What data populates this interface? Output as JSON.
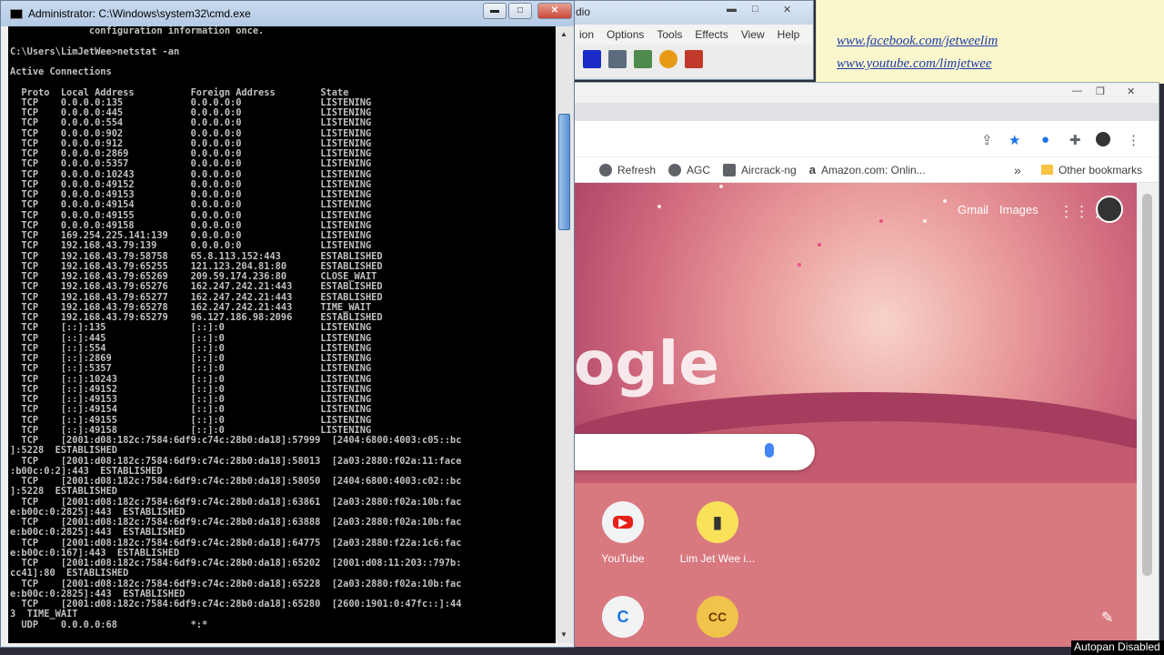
{
  "audio_app": {
    "title": "dio",
    "menu": [
      "ion",
      "Options",
      "Tools",
      "Effects",
      "View",
      "Help"
    ]
  },
  "note": {
    "link1": "www.facebook.com/jetweelim",
    "link2": "www.youtube.com/limjetwee"
  },
  "chrome": {
    "bookmarks": [
      {
        "label": "Refresh"
      },
      {
        "label": "AGC"
      },
      {
        "label": "Aircrack-ng"
      },
      {
        "label": "Amazon.com: Onlin..."
      }
    ],
    "more_bookmarks": "»",
    "other_bookmarks": "Other bookmarks",
    "gmail": "Gmail",
    "images": "Images",
    "logo_fragment": "ogle",
    "shortcuts": [
      {
        "label": "YouTube"
      },
      {
        "label": "Lim Jet Wee i..."
      }
    ]
  },
  "cmd": {
    "title": "Administrator: C:\\Windows\\system32\\cmd.exe",
    "preamble": [
      "              configuration information once.",
      "",
      "C:\\Users\\LimJetWee>netstat -an",
      "",
      "Active Connections",
      "",
      "  Proto  Local Address          Foreign Address        State"
    ],
    "rows": [
      [
        "TCP",
        "0.0.0.0:135",
        "0.0.0.0:0",
        "LISTENING"
      ],
      [
        "TCP",
        "0.0.0.0:445",
        "0.0.0.0:0",
        "LISTENING"
      ],
      [
        "TCP",
        "0.0.0.0:554",
        "0.0.0.0:0",
        "LISTENING"
      ],
      [
        "TCP",
        "0.0.0.0:902",
        "0.0.0.0:0",
        "LISTENING"
      ],
      [
        "TCP",
        "0.0.0.0:912",
        "0.0.0.0:0",
        "LISTENING"
      ],
      [
        "TCP",
        "0.0.0.0:2869",
        "0.0.0.0:0",
        "LISTENING"
      ],
      [
        "TCP",
        "0.0.0.0:5357",
        "0.0.0.0:0",
        "LISTENING"
      ],
      [
        "TCP",
        "0.0.0.0:10243",
        "0.0.0.0:0",
        "LISTENING"
      ],
      [
        "TCP",
        "0.0.0.0:49152",
        "0.0.0.0:0",
        "LISTENING"
      ],
      [
        "TCP",
        "0.0.0.0:49153",
        "0.0.0.0:0",
        "LISTENING"
      ],
      [
        "TCP",
        "0.0.0.0:49154",
        "0.0.0.0:0",
        "LISTENING"
      ],
      [
        "TCP",
        "0.0.0.0:49155",
        "0.0.0.0:0",
        "LISTENING"
      ],
      [
        "TCP",
        "0.0.0.0:49158",
        "0.0.0.0:0",
        "LISTENING"
      ],
      [
        "TCP",
        "169.254.225.141:139",
        "0.0.0.0:0",
        "LISTENING"
      ],
      [
        "TCP",
        "192.168.43.79:139",
        "0.0.0.0:0",
        "LISTENING"
      ],
      [
        "TCP",
        "192.168.43.79:58758",
        "65.8.113.152:443",
        "ESTABLISHED"
      ],
      [
        "TCP",
        "192.168.43.79:65255",
        "121.123.204.81:80",
        "ESTABLISHED"
      ],
      [
        "TCP",
        "192.168.43.79:65269",
        "209.59.174.236:80",
        "CLOSE_WAIT"
      ],
      [
        "TCP",
        "192.168.43.79:65276",
        "162.247.242.21:443",
        "ESTABLISHED"
      ],
      [
        "TCP",
        "192.168.43.79:65277",
        "162.247.242.21:443",
        "ESTABLISHED"
      ],
      [
        "TCP",
        "192.168.43.79:65278",
        "162.247.242.21:443",
        "TIME_WAIT"
      ],
      [
        "TCP",
        "192.168.43.79:65279",
        "96.127.186.98:2096",
        "ESTABLISHED"
      ],
      [
        "TCP",
        "[::]:135",
        "[::]:0",
        "LISTENING"
      ],
      [
        "TCP",
        "[::]:445",
        "[::]:0",
        "LISTENING"
      ],
      [
        "TCP",
        "[::]:554",
        "[::]:0",
        "LISTENING"
      ],
      [
        "TCP",
        "[::]:2869",
        "[::]:0",
        "LISTENING"
      ],
      [
        "TCP",
        "[::]:5357",
        "[::]:0",
        "LISTENING"
      ],
      [
        "TCP",
        "[::]:10243",
        "[::]:0",
        "LISTENING"
      ],
      [
        "TCP",
        "[::]:49152",
        "[::]:0",
        "LISTENING"
      ],
      [
        "TCP",
        "[::]:49153",
        "[::]:0",
        "LISTENING"
      ],
      [
        "TCP",
        "[::]:49154",
        "[::]:0",
        "LISTENING"
      ],
      [
        "TCP",
        "[::]:49155",
        "[::]:0",
        "LISTENING"
      ],
      [
        "TCP",
        "[::]:49158",
        "[::]:0",
        "LISTENING"
      ]
    ],
    "tail": [
      "  TCP    [2001:d08:182c:7584:6df9:c74c:28b0:da18]:57999  [2404:6800:4003:c05::bc",
      "]:5228  ESTABLISHED",
      "  TCP    [2001:d08:182c:7584:6df9:c74c:28b0:da18]:58013  [2a03:2880:f02a:11:face",
      ":b00c:0:2]:443  ESTABLISHED",
      "  TCP    [2001:d08:182c:7584:6df9:c74c:28b0:da18]:58050  [2404:6800:4003:c02::bc",
      "]:5228  ESTABLISHED",
      "  TCP    [2001:d08:182c:7584:6df9:c74c:28b0:da18]:63861  [2a03:2880:f02a:10b:fac",
      "e:b00c:0:2825]:443  ESTABLISHED",
      "  TCP    [2001:d08:182c:7584:6df9:c74c:28b0:da18]:63888  [2a03:2880:f02a:10b:fac",
      "e:b00c:0:2825]:443  ESTABLISHED",
      "  TCP    [2001:d08:182c:7584:6df9:c74c:28b0:da18]:64775  [2a03:2880:f22a:1c6:fac",
      "e:b00c:0:167]:443  ESTABLISHED",
      "  TCP    [2001:d08:182c:7584:6df9:c74c:28b0:da18]:65202  [2001:d08:11:203::797b:",
      "cc41]:80  ESTABLISHED",
      "  TCP    [2001:d08:182c:7584:6df9:c74c:28b0:da18]:65228  [2a03:2880:f02a:10b:fac",
      "e:b00c:0:2825]:443  ESTABLISHED",
      "  TCP    [2001:d08:182c:7584:6df9:c74c:28b0:da18]:65280  [2600:1901:0:47fc::]:44",
      "3  TIME_WAIT",
      "  UDP    0.0.0.0:68             *:*"
    ]
  },
  "overlay": {
    "autopan": "Autopan Disabled"
  }
}
